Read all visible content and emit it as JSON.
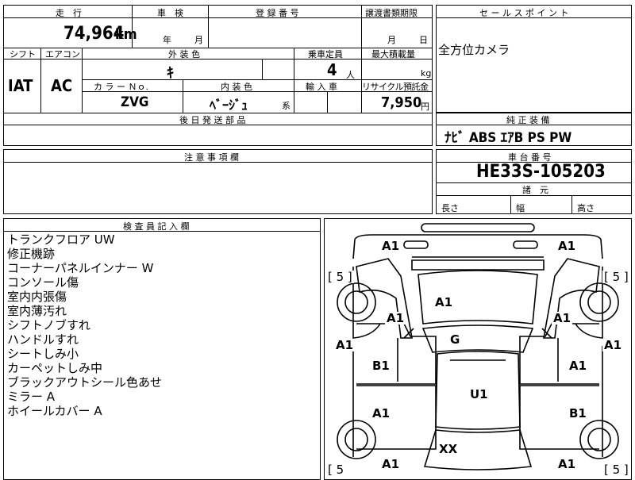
{
  "table": {
    "mileage_label": "走　行",
    "inspection_label": "車　検",
    "registration_label": "登 録 番 号",
    "transfer_docs_label": "譲渡書類期限",
    "mileage_value": "74,964",
    "mileage_unit": "km",
    "year_unit": "年",
    "month_unit": "月",
    "transfer_month_unit": "月",
    "transfer_day_unit": "日",
    "shift_label": "シフト",
    "ac_label": "エアコン",
    "exterior_color_label": "外 装 色",
    "capacity_label": "乗車定員",
    "max_load_label": "最大積載量",
    "shift_value": "IAT",
    "ac_value": "AC",
    "exterior_color_value": "ｷ",
    "capacity_value": "4",
    "capacity_unit": "人",
    "load_unit": "kg",
    "color_no_label": "カ ラ ー Ｎｏ.",
    "interior_color_label": "内 装 色",
    "import_label": "輸 入 車",
    "recycle_label": "リサイクル預託金",
    "color_no_value": "ZVG",
    "interior_color_value": "ﾍﾞｰｼﾞｭ",
    "interior_suffix": "系",
    "recycle_value": "7,950",
    "recycle_unit": "円",
    "later_parts_label": "後 日 発 送 部 品"
  },
  "sales_point": {
    "label": "セ ー ル ス ポ イ ン ト",
    "value": "全方位カメラ"
  },
  "equipment": {
    "label": "純 正 装 備",
    "value": "ﾅﾋﾞ  ABS  ｴｱB  PS  PW"
  },
  "caution": {
    "label": "注 意 事 項 欄"
  },
  "chassis": {
    "label": "車 台 番 号",
    "value": "HE33S-105203",
    "dims_label": "諸　元",
    "length_label": "長さ",
    "width_label": "幅",
    "height_label": "高さ"
  },
  "inspector": {
    "label": "検 査 員 記 入 欄",
    "notes": [
      "トランクフロア UW",
      "修正機跡",
      "コーナーパネルインナー W",
      "コンソール傷",
      "室内内張傷",
      "室内薄汚れ",
      "シフトノブすれ",
      "ハンドルすれ",
      "シートしみ小",
      "カーペットしみ中",
      "ブラックアウトシール色あせ",
      "ミラー A",
      "ホイールカバー A"
    ]
  },
  "diagram": {
    "tire_top_left": "[ 5 ]",
    "tire_top_right": "[ 5 ]",
    "tire_bottom_left": "[ 5",
    "tire_bottom_right": "[ 5 ]",
    "mark_front_left_corner": "A1",
    "mark_front_right_corner": "A1",
    "mark_hood": "A1",
    "mark_front_left_fender": "A1",
    "mark_front_right_fender": "A1",
    "mark_left_side_front": "A1",
    "mark_right_side_front": "A1",
    "mark_windshield": "G",
    "mark_front_left_door": "B1",
    "mark_front_right_door": "A1",
    "mark_roof": "U1",
    "mark_rear_left_door": "A1",
    "mark_rear_right_door": "B1",
    "mark_rear_glass": "XX",
    "mark_rear_left_corner": "A1",
    "mark_rear_right_corner": "A1"
  }
}
